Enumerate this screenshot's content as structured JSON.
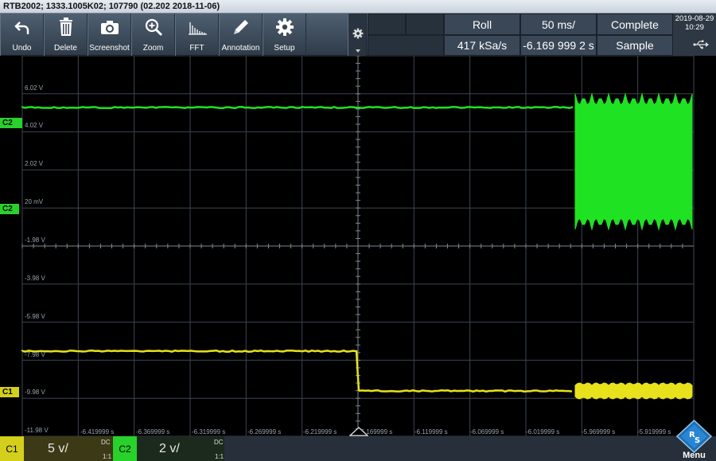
{
  "window": {
    "title": "RTB2002; 1333.1005K02; 107790 (02.202 2018-11-06)"
  },
  "toolbar": {
    "buttons": [
      {
        "name": "undo-button",
        "icon": "undo-icon",
        "label": "Undo"
      },
      {
        "name": "delete-button",
        "icon": "trash-icon",
        "label": "Delete"
      },
      {
        "name": "screenshot-button",
        "icon": "camera-icon",
        "label": "Screenshot"
      },
      {
        "name": "zoom-button",
        "icon": "zoom-icon",
        "label": "Zoom"
      },
      {
        "name": "fft-button",
        "icon": "fft-icon",
        "label": "FFT"
      },
      {
        "name": "annotation-button",
        "icon": "pencil-icon",
        "label": "Annotation"
      },
      {
        "name": "setup-button",
        "icon": "gear-icon",
        "label": "Setup"
      }
    ]
  },
  "status": {
    "mode": "Roll",
    "timebase": "50 ms/",
    "acq_state": "Complete",
    "sample_rate": "417 kSa/s",
    "position": "-6.169 999 2 s",
    "acq_mode": "Sample",
    "date": "2019-08-29",
    "time": "10:29"
  },
  "axes": {
    "y_labels": [
      "6.02 V",
      "4.02 V",
      "2.02 V",
      "20 mV",
      "-1.98 V",
      "-3.98 V",
      "-5.98 V",
      "-7.98 V",
      "-9.98 V",
      "-11.98 V"
    ],
    "x_labels": [
      "-6.419999 s",
      "-6.369999 s",
      "-6.319999 s",
      "-6.269999 s",
      "-6.219999 s",
      "-6.169999 s",
      "-6.119999 s",
      "-6.069999 s",
      "-6.019999 s",
      "-5.969999 s",
      "-5.919999 s"
    ]
  },
  "markers": {
    "c2_upper": "C2",
    "c2_lower": "C2",
    "c1": "C1"
  },
  "channels": [
    {
      "tag": "C1",
      "scale": "5 v/",
      "coupling": "DC",
      "probe": "1:1",
      "color": "#d4cf1a"
    },
    {
      "tag": "C2",
      "scale": "2 v/",
      "coupling": "DC",
      "probe": "1:1",
      "color": "#27d22a"
    }
  ],
  "menu": {
    "label": "Menu",
    "logo": "rs-logo"
  },
  "colors": {
    "ch1": "#e7e21c",
    "ch2": "#1fe223",
    "grid": "#3c4552"
  }
}
